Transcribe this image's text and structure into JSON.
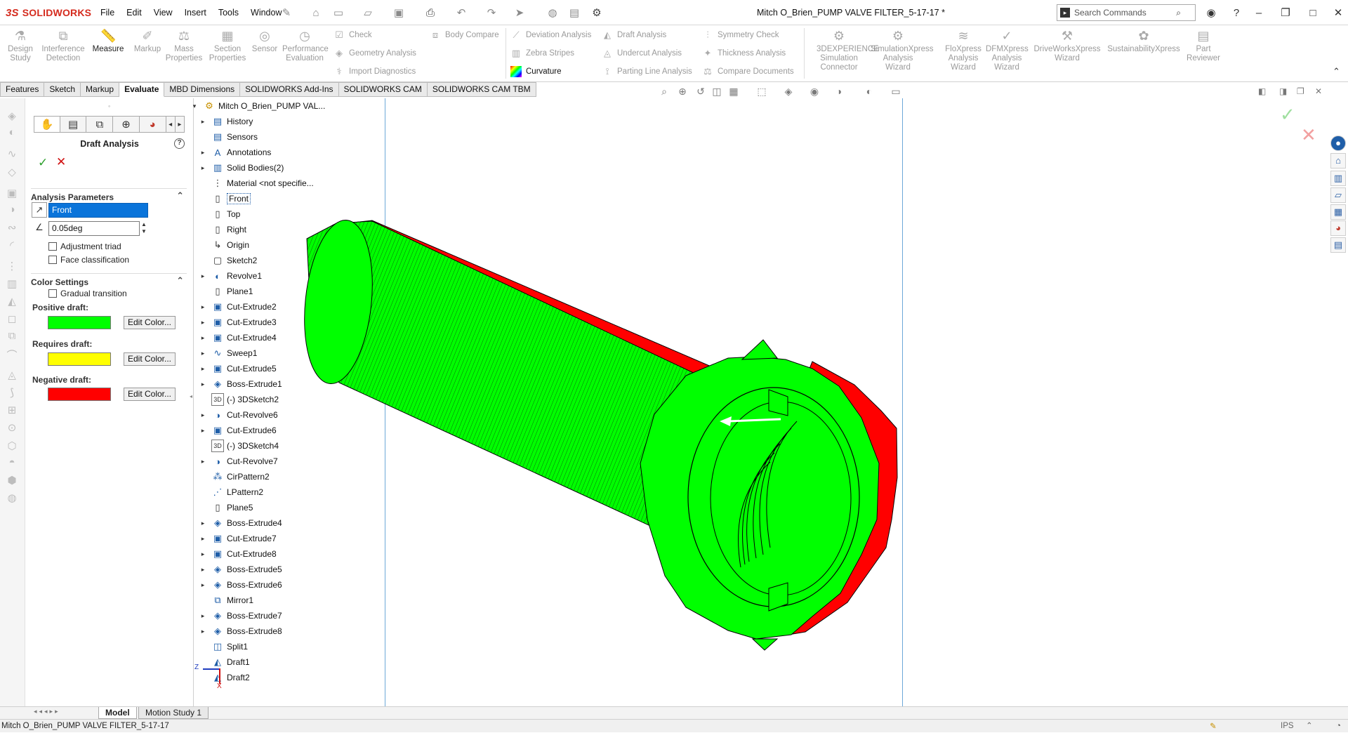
{
  "app": {
    "logo_text": "SOLIDWORKS",
    "logo_glyph": "3S",
    "doc_title": "Mitch O_Brien_PUMP VALVE FILTER_5-17-17 *"
  },
  "menus": [
    "File",
    "Edit",
    "View",
    "Insert",
    "Tools",
    "Window"
  ],
  "search": {
    "placeholder": "Search Commands"
  },
  "toolbar": {
    "big_tools": [
      {
        "label": "Design Study",
        "icon": "design-study-icon"
      },
      {
        "label": "Interference Detection",
        "icon": "interference-icon"
      },
      {
        "label": "Measure",
        "icon": "measure-icon"
      },
      {
        "label": "Markup",
        "icon": "markup-icon"
      },
      {
        "label": "Mass Properties",
        "icon": "mass-properties-icon"
      },
      {
        "label": "Section Properties",
        "icon": "section-properties-icon"
      },
      {
        "label": "Sensor",
        "icon": "sensor-icon"
      },
      {
        "label": "Performance Evaluation",
        "icon": "performance-icon"
      }
    ],
    "small_col1": [
      "Check",
      "Geometry Analysis",
      "Import Diagnostics"
    ],
    "small_col2": [
      "Body Compare"
    ],
    "small_col3": [
      "Deviation Analysis",
      "Zebra Stripes",
      "Curvature"
    ],
    "small_col4": [
      "Draft Analysis",
      "Undercut Analysis",
      "Parting Line Analysis"
    ],
    "small_col5": [
      "Symmetry Check",
      "Thickness Analysis",
      "Compare Documents"
    ],
    "right_tools": [
      {
        "label": "3DEXPERIENCE Simulation Connector"
      },
      {
        "label": "SimulationXpress Analysis Wizard"
      },
      {
        "label": "FloXpress Analysis Wizard"
      },
      {
        "label": "DFMXpress Analysis Wizard"
      },
      {
        "label": "DriveWorksXpress Wizard"
      },
      {
        "label": "SustainabilityXpress"
      },
      {
        "label": "Part Reviewer"
      }
    ]
  },
  "tabs": [
    "Features",
    "Sketch",
    "Markup",
    "Evaluate",
    "MBD Dimensions",
    "SOLIDWORKS Add-Ins",
    "SOLIDWORKS CAM",
    "SOLIDWORKS CAM TBM"
  ],
  "property_manager": {
    "title": "Draft Analysis",
    "analysis_header": "Analysis Parameters",
    "direction_value": "Front",
    "angle_value": "0.05deg",
    "adjustment_triad": "Adjustment triad",
    "face_classification": "Face classification",
    "color_header": "Color Settings",
    "gradual_transition": "Gradual transition",
    "positive_label": "Positive draft:",
    "requires_label": "Requires draft:",
    "negative_label": "Negative draft:",
    "edit_color": "Edit Color...",
    "colors": {
      "positive": "#00ff00",
      "requires": "#ffff00",
      "negative": "#ff0000"
    }
  },
  "tree": {
    "root": "Mitch O_Brien_PUMP VAL...",
    "items": [
      {
        "name": "History",
        "expand": true,
        "icon": "folder-history-icon"
      },
      {
        "name": "Sensors",
        "expand": false,
        "icon": "folder-sensors-icon"
      },
      {
        "name": "Annotations",
        "expand": true,
        "icon": "annotations-icon"
      },
      {
        "name": "Solid Bodies(2)",
        "expand": true,
        "icon": "solid-bodies-icon"
      },
      {
        "name": "Material <not specifie...",
        "expand": false,
        "icon": "material-icon"
      },
      {
        "name": "Front",
        "expand": false,
        "icon": "plane-icon",
        "selected": true
      },
      {
        "name": "Top",
        "expand": false,
        "icon": "plane-icon"
      },
      {
        "name": "Right",
        "expand": false,
        "icon": "plane-icon"
      },
      {
        "name": "Origin",
        "expand": false,
        "icon": "origin-icon"
      },
      {
        "name": "Sketch2",
        "expand": false,
        "icon": "sketch-icon"
      },
      {
        "name": "Revolve1",
        "expand": true,
        "icon": "revolve-icon"
      },
      {
        "name": "Plane1",
        "expand": false,
        "icon": "plane-icon"
      },
      {
        "name": "Cut-Extrude2",
        "expand": true,
        "icon": "cut-extrude-icon"
      },
      {
        "name": "Cut-Extrude3",
        "expand": true,
        "icon": "cut-extrude-icon"
      },
      {
        "name": "Cut-Extrude4",
        "expand": true,
        "icon": "cut-extrude-icon"
      },
      {
        "name": "Sweep1",
        "expand": true,
        "icon": "sweep-icon"
      },
      {
        "name": "Cut-Extrude5",
        "expand": true,
        "icon": "cut-extrude-icon"
      },
      {
        "name": "Boss-Extrude1",
        "expand": true,
        "icon": "boss-extrude-icon"
      },
      {
        "name": "(-) 3DSketch2",
        "expand": false,
        "icon": "3d-sketch-icon"
      },
      {
        "name": "Cut-Revolve6",
        "expand": true,
        "icon": "cut-revolve-icon"
      },
      {
        "name": "Cut-Extrude6",
        "expand": true,
        "icon": "cut-extrude-icon"
      },
      {
        "name": "(-) 3DSketch4",
        "expand": false,
        "icon": "3d-sketch-icon"
      },
      {
        "name": "Cut-Revolve7",
        "expand": true,
        "icon": "cut-revolve-icon"
      },
      {
        "name": "CirPattern2",
        "expand": false,
        "icon": "circular-pattern-icon"
      },
      {
        "name": "LPattern2",
        "expand": false,
        "icon": "linear-pattern-icon"
      },
      {
        "name": "Plane5",
        "expand": false,
        "icon": "plane-icon"
      },
      {
        "name": "Boss-Extrude4",
        "expand": true,
        "icon": "boss-extrude-icon"
      },
      {
        "name": "Cut-Extrude7",
        "expand": true,
        "icon": "cut-extrude-icon"
      },
      {
        "name": "Cut-Extrude8",
        "expand": true,
        "icon": "cut-extrude-icon"
      },
      {
        "name": "Boss-Extrude5",
        "expand": true,
        "icon": "boss-extrude-icon"
      },
      {
        "name": "Boss-Extrude6",
        "expand": true,
        "icon": "boss-extrude-icon"
      },
      {
        "name": "Mirror1",
        "expand": false,
        "icon": "mirror-icon"
      },
      {
        "name": "Boss-Extrude7",
        "expand": true,
        "icon": "boss-extrude-icon"
      },
      {
        "name": "Boss-Extrude8",
        "expand": true,
        "icon": "boss-extrude-icon"
      },
      {
        "name": "Split1",
        "expand": false,
        "icon": "split-icon"
      },
      {
        "name": "Draft1",
        "expand": false,
        "icon": "draft-icon"
      },
      {
        "name": "Draft2",
        "expand": false,
        "icon": "draft-icon"
      }
    ]
  },
  "bottom_tabs": [
    "Model",
    "Motion Study 1"
  ],
  "status": {
    "text": "Mitch O_Brien_PUMP VALVE FILTER_5-17-17",
    "units": "IPS"
  },
  "triad": {
    "z": "Z",
    "x": "X"
  }
}
